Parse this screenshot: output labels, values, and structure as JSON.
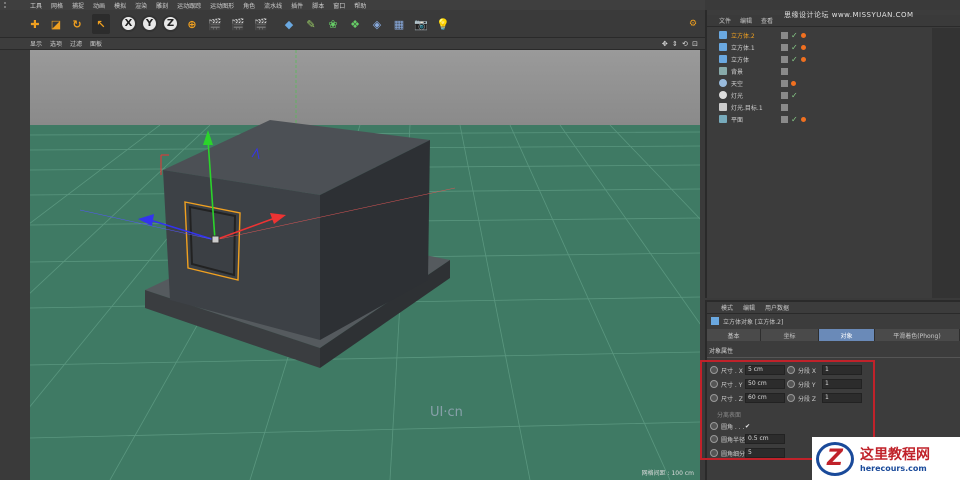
{
  "menu": [
    "工具",
    "网格",
    "捕捉",
    "动画",
    "模拟",
    "渲染",
    "雕刻",
    "运动跟踪",
    "运动图形",
    "角色",
    "流水线",
    "插件",
    "脚本",
    "窗口",
    "帮助"
  ],
  "viewport_menu": [
    "显示",
    "选项",
    "过滤",
    "面板"
  ],
  "viewport_status": "网格间距 : 100 cm",
  "viewport_watermark": "UI·cn",
  "top_watermark": "思缘设计论坛 www.MISSYUAN.COM",
  "object_manager": {
    "menu": [
      "文件",
      "编辑",
      "查看"
    ],
    "objects": [
      {
        "name": "立方体.2",
        "active": true
      },
      {
        "name": "立方体.1",
        "active": false
      },
      {
        "name": "立方体",
        "active": false
      },
      {
        "name": "背景",
        "active": false
      },
      {
        "name": "天空",
        "active": false
      },
      {
        "name": "灯光",
        "active": false
      },
      {
        "name": "灯光.目标.1",
        "active": false
      },
      {
        "name": "平面",
        "active": false
      }
    ]
  },
  "attributes": {
    "menu": [
      "模式",
      "编辑",
      "用户数据"
    ],
    "object_title": "立方体对象 [立方体.2]",
    "tabs": [
      "基本",
      "坐标",
      "对象",
      "平滑着色(Phong)"
    ],
    "active_tab": "对象",
    "section": "对象属性",
    "size_x_label": "尺寸 . X",
    "size_x": "5 cm",
    "size_y_label": "尺寸 . Y",
    "size_y": "50 cm",
    "size_z_label": "尺寸 . Z",
    "size_z": "60 cm",
    "seg_x_label": "分段 X",
    "seg_x": "1",
    "seg_y_label": "分段 Y",
    "seg_y": "1",
    "seg_z_label": "分段 Z",
    "seg_z": "1",
    "separate_label": "分离表面",
    "fillet_label": "圆角 . . .",
    "fillet_check": "✔",
    "fillet_radius_label": "圆角半径",
    "fillet_radius": "0.5 cm",
    "fillet_sub_label": "圆角细分",
    "fillet_sub": "5"
  },
  "logo": {
    "title": "这里教程网",
    "url": "herecours.com"
  },
  "colors": {
    "ground": "#3f7a64",
    "accent": "#f0a020",
    "highlight": "#c0222a"
  }
}
